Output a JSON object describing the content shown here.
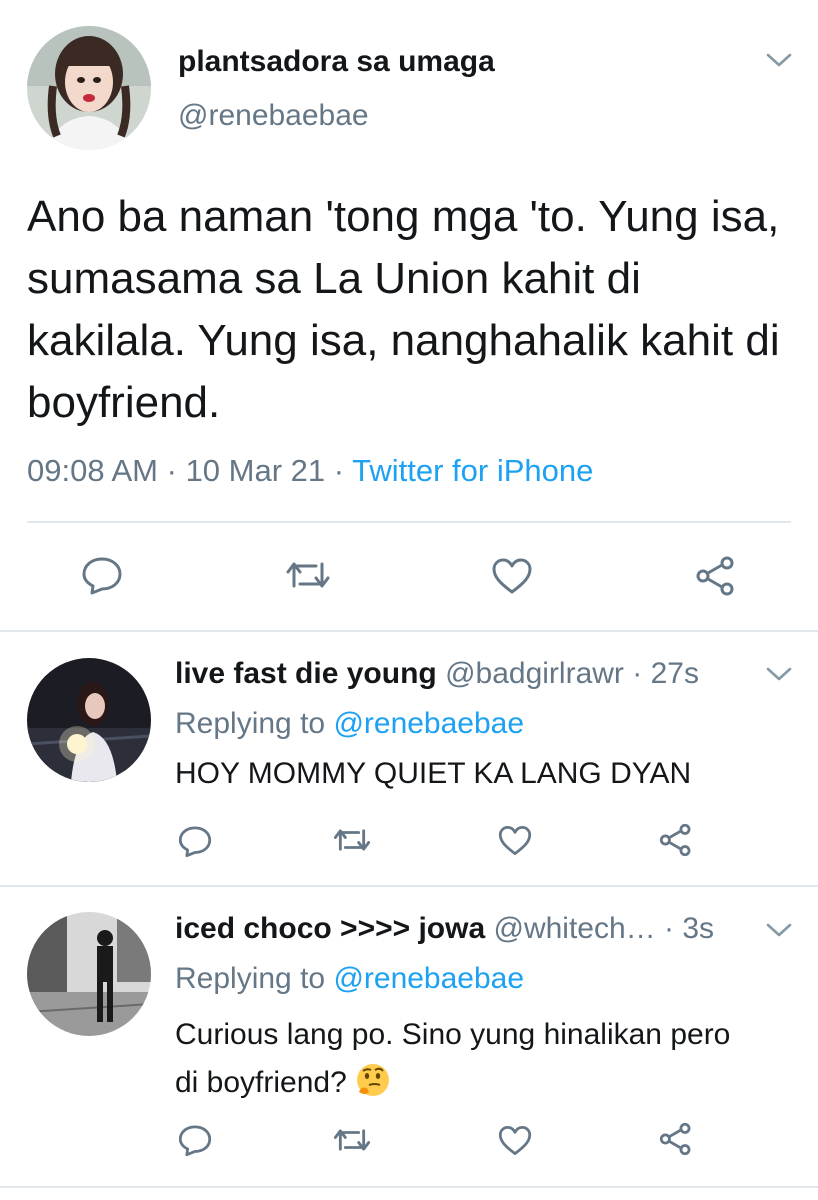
{
  "main_tweet": {
    "display_name": "plantsadora sa umaga",
    "handle": "@renebaebae",
    "text": "Ano ba naman 'tong mga 'to. Yung isa, sumasama sa La Union kahit di kakilala. Yung isa, nanghahalik kahit di boyfriend.",
    "time": "09:08 AM",
    "dot1": "·",
    "date": "10 Mar 21",
    "dot2": "·",
    "source": "Twitter for iPhone",
    "avatar_icon": "profile-photo",
    "chevron_icon": "chevron-down-icon",
    "actions": [
      "reply-icon",
      "retweet-icon",
      "like-icon",
      "share-icon"
    ]
  },
  "replies": [
    {
      "display_name": "live fast die young",
      "handle": "@badgirlrawr",
      "age": "· 27s",
      "replying_label": "Replying to",
      "replying_to": "@renebaebae",
      "text": "HOY MOMMY QUIET KA LANG DYAN"
    },
    {
      "display_name": "iced choco >>>> jowa",
      "handle": "@whitech…",
      "age": "· 3s",
      "replying_label": "Replying to",
      "replying_to": "@renebaebae",
      "text_line1": "Curious lang po. Sino yung hinalikan pero",
      "text_line2": "di boyfriend?",
      "emoji": "thinking-face-emoji"
    }
  ],
  "colors": {
    "text": "#14171a",
    "muted": "#657786",
    "link": "#1da1f2",
    "divider": "#e1e8ed"
  }
}
